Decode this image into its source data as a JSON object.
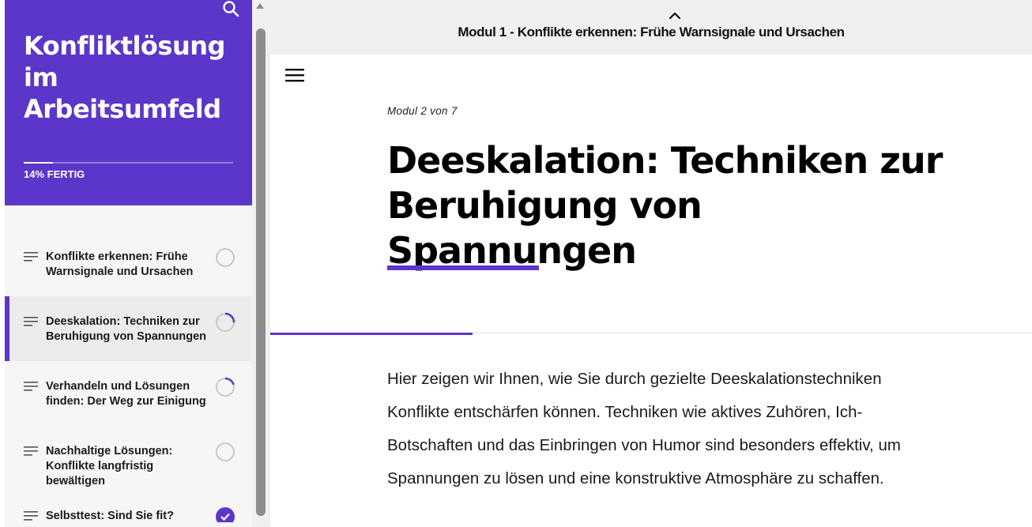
{
  "course": {
    "title": "Konfliktlösung im Arbeitsumfeld",
    "progress_percent": 14,
    "progress_label": "14% FERTIG"
  },
  "lessons": [
    {
      "title": "Konflikte erkennen: Frühe Warnsignale und Ursachen",
      "status": "not-started",
      "progress": 0
    },
    {
      "title": "Deeskalation: Techniken zur Beruhigung von Spannungen",
      "status": "in-progress",
      "progress": 0.25,
      "active": true
    },
    {
      "title": "Verhandeln und Lösungen finden: Der Weg zur Einigung",
      "status": "in-progress",
      "progress": 0.2
    },
    {
      "title": "Nachhaltige Lösungen: Konflikte langfristig bewältigen",
      "status": "not-started",
      "progress": 0
    },
    {
      "title": "Selbsttest: Sind Sie fit?",
      "status": "completed",
      "progress": 1
    }
  ],
  "nav": {
    "previous_label": "Modul 1 - Konflikte erkennen: Frühe Warnsignale und Ursachen"
  },
  "main": {
    "module_count": "Modul 2 von 7",
    "heading": "Deeskalation: Techniken zur Beruhigung von Spannungen",
    "body": "Hier zeigen wir Ihnen, wie Sie durch gezielte Deeskalationstechniken Konflikte entschärfen können. Techniken wie aktives Zuhören, Ich-Botschaften und das Einbringen von Humor sind besonders effektiv, um Spannungen zu lösen und eine konstruktive Atmosphäre zu schaffen."
  },
  "colors": {
    "accent": "#5c36c9",
    "sidebar_bg": "#f6f6f6",
    "topbar_bg": "#f0f0f0"
  },
  "icons": {
    "search": "search-icon",
    "menu": "hamburger-menu-icon",
    "chevron": "chevron-up-icon",
    "lesson": "lesson-lines-icon",
    "status": "progress-ring-icon"
  }
}
